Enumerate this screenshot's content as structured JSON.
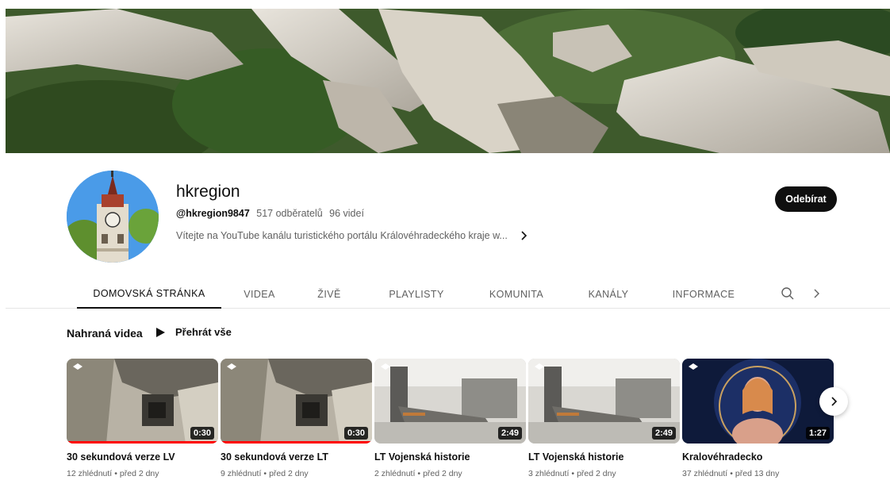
{
  "channel": {
    "name": "hkregion",
    "handle": "@hkregion9847",
    "subscribers": "517 odběratelů",
    "videos": "96 videí",
    "description": "Vítejte na YouTube kanálu turistického portálu Královéhradeckého kraje w...",
    "subscribe_label": "Odebírat"
  },
  "tabs": [
    {
      "label": "DOMOVSKÁ STRÁNKA",
      "active": true
    },
    {
      "label": "VIDEA"
    },
    {
      "label": "ŽIVĚ"
    },
    {
      "label": "PLAYLISTY"
    },
    {
      "label": "KOMUNITA"
    },
    {
      "label": "KANÁLY"
    },
    {
      "label": "INFORMACE"
    }
  ],
  "icons": {
    "search": "search-icon",
    "tabs_next": "chevron-right-icon",
    "desc_more": "chevron-right-icon",
    "play": "play-icon"
  },
  "section": {
    "title": "Nahraná videa",
    "play_all": "Přehrát vše"
  },
  "videos": [
    {
      "title": "30 sekundová verze LV",
      "views": "12 zhlédnutí",
      "age": "před 2 dny",
      "duration": "0:30",
      "watched_fraction": 1.0,
      "thumb": "castle"
    },
    {
      "title": "30 sekundová verze LT",
      "views": "9 zhlédnutí",
      "age": "před 2 dny",
      "duration": "0:30",
      "watched_fraction": 1.0,
      "thumb": "castle"
    },
    {
      "title": "LT Vojenská historie",
      "views": "2 zhlédnutí",
      "age": "před 2 dny",
      "duration": "2:49",
      "watched_fraction": 0.0,
      "thumb": "cannon"
    },
    {
      "title": "LT Vojenská historie",
      "views": "3 zhlédnutí",
      "age": "před 2 dny",
      "duration": "2:49",
      "watched_fraction": 0.0,
      "thumb": "cannon"
    },
    {
      "title": "Kralovéhradecko",
      "views": "37 zhlédnutí",
      "age": "před 13 dny",
      "duration": "1:27",
      "watched_fraction": 0.0,
      "thumb": "performer"
    }
  ],
  "colors": {
    "accent": "#0f0f0f",
    "progress": "#ff0000",
    "muted": "#606060"
  }
}
